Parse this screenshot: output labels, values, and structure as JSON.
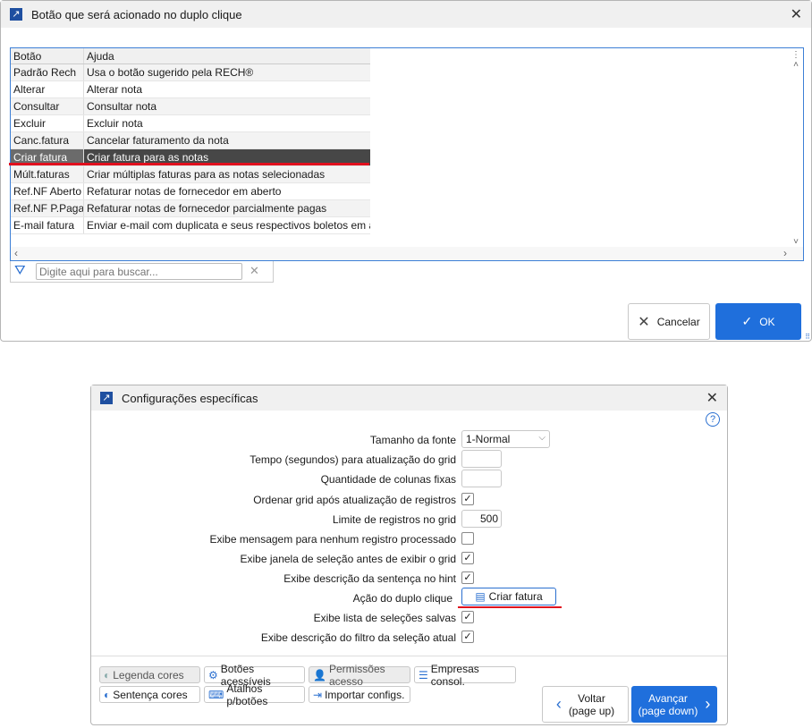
{
  "dialog1": {
    "title": "Botão que será acionado no duplo clique",
    "columns": [
      "Botão",
      "Ajuda"
    ],
    "rows": [
      {
        "botao": "Padrão Rech",
        "ajuda": "Usa o botão sugerido pela RECH®"
      },
      {
        "botao": "Alterar",
        "ajuda": "Alterar nota"
      },
      {
        "botao": "Consultar",
        "ajuda": "Consultar nota"
      },
      {
        "botao": "Excluir",
        "ajuda": "Excluir nota"
      },
      {
        "botao": "Canc.fatura",
        "ajuda": "Cancelar faturamento da nota"
      },
      {
        "botao": "Criar fatura",
        "ajuda": "Criar fatura para as notas"
      },
      {
        "botao": "Múlt.faturas",
        "ajuda": "Criar múltiplas faturas para as notas selecionadas"
      },
      {
        "botao": "Ref.NF Aberto",
        "ajuda": "Refaturar notas de fornecedor em aberto"
      },
      {
        "botao": "Ref.NF P.Paga",
        "ajuda": "Refaturar notas de fornecedor parcialmente pagas"
      },
      {
        "botao": "E-mail fatura",
        "ajuda": "Enviar e-mail com duplicata e seus respectivos boletos em anexo"
      }
    ],
    "selected_index": 5,
    "search_placeholder": "Digite aqui para buscar...",
    "cancel_label": "Cancelar",
    "ok_label": "OK"
  },
  "dialog2": {
    "title": "Configurações específicas",
    "fields": {
      "font_size": {
        "label": "Tamanho da fonte",
        "value": "1-Normal"
      },
      "refresh_time": {
        "label": "Tempo (segundos) para atualização do grid",
        "value": ""
      },
      "fixed_columns": {
        "label": "Quantidade de colunas fixas",
        "value": ""
      },
      "sort_grid": {
        "label": "Ordenar grid após atualização de registros",
        "checked": true
      },
      "record_limit": {
        "label": "Limite de registros no grid",
        "value": "500"
      },
      "no_record_msg": {
        "label": "Exibe mensagem para nenhum registro processado",
        "checked": false
      },
      "selection_window": {
        "label": "Exibe janela de seleção antes de exibir o grid",
        "checked": true
      },
      "sentence_hint": {
        "label": "Exibe descrição da sentença no hint",
        "checked": true
      },
      "double_click": {
        "label": "Ação do duplo clique",
        "value": "Criar fatura"
      },
      "saved_selections": {
        "label": "Exibe lista de seleções salvas",
        "checked": true
      },
      "filter_desc": {
        "label": "Exibe descrição do filtro da seleção atual",
        "checked": true
      }
    },
    "buttons": {
      "legenda": "Legenda cores",
      "botoes": "Botões acessíveis",
      "permissoes": "Permissões acesso",
      "empresas": "Empresas consol.",
      "sentenca": "Sentença cores",
      "atalhos": "Atalhos p/botões",
      "importar": "Importar configs."
    },
    "back_label": "Voltar",
    "back_sub": "(page up)",
    "next_label": "Avançar",
    "next_sub": "(page down)"
  },
  "colors": {
    "accent": "#1f6fdc",
    "highlight_underline": "#e0101e"
  }
}
